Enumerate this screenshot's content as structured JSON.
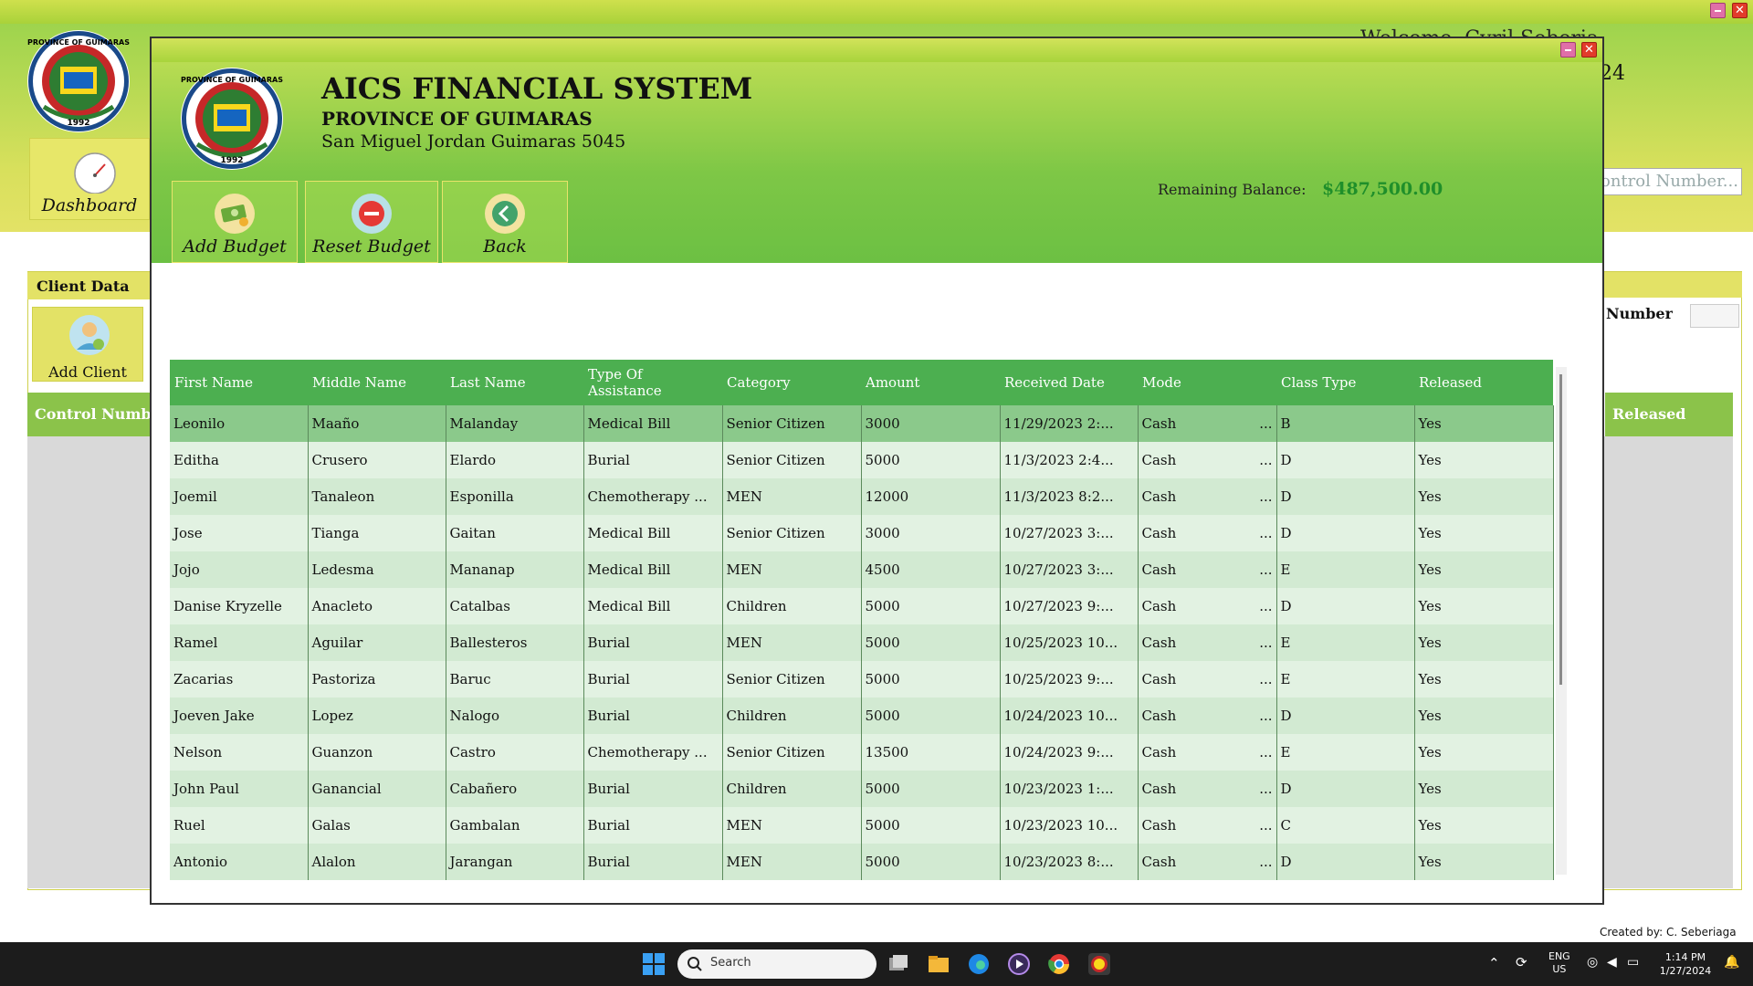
{
  "background_app": {
    "welcome_text": "Welcome, Cyril Seberiaga",
    "date_text": "24",
    "dashboard_label": "Dashboard",
    "search_placeholder": "ontrol Number...",
    "client_data_label": "Client Data",
    "add_client_label": "Add Client",
    "control_number_label": "d Number:",
    "control_column_header": "Control Numbe",
    "released_column_header": "Released",
    "credit": "Created by: C. Seberiaga",
    "seal_text_top": "PROVINCE OF GUIMARAS",
    "seal_year": "1992"
  },
  "dialog": {
    "title": "AICS FINANCIAL SYSTEM",
    "subtitle": "PROVINCE OF GUIMARAS",
    "address": "San Miguel Jordan Guimaras 5045",
    "seal_text_top": "PROVINCE OF GUIMARAS",
    "seal_year": "1992",
    "toolbar": {
      "add_budget": "Add Budget",
      "reset_budget": "Reset Budget",
      "back": "Back"
    },
    "remaining_balance_label": "Remaining Balance:",
    "remaining_balance_value": "$487,500.00"
  },
  "table": {
    "columns": [
      "First Name",
      "Middle Name",
      "Last Name",
      "Type Of Assistance",
      "Category",
      "Amount",
      "Received Date",
      "Mode",
      "Class Type",
      "Released"
    ],
    "rows": [
      [
        "Leonilo",
        "Maaño",
        "Malanday",
        "Medical Bill",
        "Senior Citizen",
        "3000",
        "11/29/2023 2:...",
        "Cash",
        "B",
        "Yes"
      ],
      [
        "Editha",
        "Crusero",
        "Elardo",
        "Burial",
        "Senior Citizen",
        "5000",
        "11/3/2023 2:4...",
        "Cash",
        "D",
        "Yes"
      ],
      [
        "Joemil",
        "Tanaleon",
        "Esponilla",
        "Chemotherapy ...",
        "MEN",
        "12000",
        "11/3/2023 8:2...",
        "Cash",
        "D",
        "Yes"
      ],
      [
        "Jose",
        "Tianga",
        "Gaitan",
        "Medical Bill",
        "Senior Citizen",
        "3000",
        "10/27/2023 3:...",
        "Cash",
        "D",
        "Yes"
      ],
      [
        "Jojo",
        "Ledesma",
        "Mananap",
        "Medical Bill",
        "MEN",
        "4500",
        "10/27/2023 3:...",
        "Cash",
        "E",
        "Yes"
      ],
      [
        "Danise Kryzelle",
        "Anacleto",
        "Catalbas",
        "Medical Bill",
        "Children",
        "5000",
        "10/27/2023 9:...",
        "Cash",
        "D",
        "Yes"
      ],
      [
        "Ramel",
        "Aguilar",
        "Ballesteros",
        "Burial",
        "MEN",
        "5000",
        "10/25/2023 10...",
        "Cash",
        "E",
        "Yes"
      ],
      [
        "Zacarias",
        "Pastoriza",
        "Baruc",
        "Burial",
        "Senior Citizen",
        "5000",
        "10/25/2023 9:...",
        "Cash",
        "E",
        "Yes"
      ],
      [
        "Joeven Jake",
        "Lopez",
        "Nalogo",
        "Burial",
        "Children",
        "5000",
        "10/24/2023 10...",
        "Cash",
        "D",
        "Yes"
      ],
      [
        "Nelson",
        "Guanzon",
        "Castro",
        "Chemotherapy ...",
        "Senior Citizen",
        "13500",
        "10/24/2023 9:...",
        "Cash",
        "E",
        "Yes"
      ],
      [
        "John Paul",
        "Ganancial",
        "Cabañero",
        "Burial",
        "Children",
        "5000",
        "10/23/2023 1:...",
        "Cash",
        "D",
        "Yes"
      ],
      [
        "Ruel",
        "Galas",
        "Gambalan",
        "Burial",
        "MEN",
        "5000",
        "10/23/2023 10...",
        "Cash",
        "C",
        "Yes"
      ],
      [
        "Antonio",
        "Alalon",
        "Jarangan",
        "Burial",
        "MEN",
        "5000",
        "10/23/2023 8:...",
        "Cash",
        "D",
        "Yes"
      ]
    ]
  },
  "taskbar": {
    "search_label": "Search",
    "lang_top": "ENG",
    "lang_bottom": "US",
    "time": "1:14 PM",
    "date": "1/27/2024",
    "apps": [
      "task-view-icon",
      "file-explorer-icon",
      "edge-icon",
      "media-player-icon",
      "chrome-icon",
      "aics-app-icon"
    ]
  },
  "colors": {
    "header_green": "#6cc043",
    "table_header": "#4caf50",
    "balance_green": "#1f8f2a",
    "row_selected": "#8bc98b"
  }
}
